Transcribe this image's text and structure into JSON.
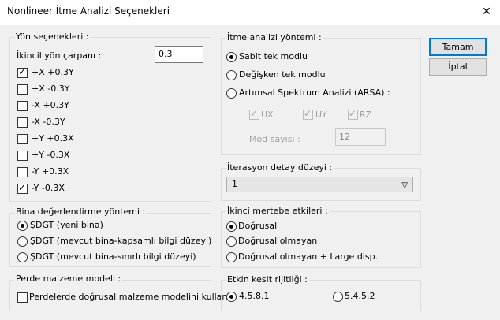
{
  "window": {
    "title": "Nonlineer İtme Analizi Seçenekleri",
    "close_symbol": "✕"
  },
  "yon": {
    "title": "Yön seçenekleri :",
    "ikincil_label": "İkincil yön çarpanı :",
    "ikincil_value": "0.3",
    "items": [
      {
        "label": "+X +0.3Y",
        "checked": true
      },
      {
        "label": "+X -0.3Y",
        "checked": false
      },
      {
        "label": "-X +0.3Y",
        "checked": false
      },
      {
        "label": "-X -0.3Y",
        "checked": false
      },
      {
        "label": "+Y +0.3X",
        "checked": false
      },
      {
        "label": "+Y -0.3X",
        "checked": false
      },
      {
        "label": "-Y +0.3X",
        "checked": false
      },
      {
        "label": "-Y -0.3X",
        "checked": true
      }
    ]
  },
  "bina": {
    "title": "Bina değerlendirme yöntemi :",
    "options": [
      {
        "label": "ŞDGT (yeni bina)",
        "checked": true
      },
      {
        "label": "ŞDGT (mevcut bina-kapsamlı bilgi düzeyi)",
        "checked": false
      },
      {
        "label": "ŞDGT (mevcut bina-sınırlı bilgi düzeyi)",
        "checked": false
      }
    ]
  },
  "perde": {
    "title": "Perde malzeme modeli :",
    "checkbox_label": "Perdelerde doğrusal malzeme modelini kullan"
  },
  "itme": {
    "title": "İtme analizi yöntemi :",
    "options": [
      {
        "label": "Sabit tek modlu",
        "checked": true
      },
      {
        "label": "Değişken tek modlu",
        "checked": false
      },
      {
        "label": "Artımsal Spektrum Analizi (ARSA) :",
        "checked": false
      }
    ],
    "arsa": {
      "ux": "UX",
      "uy": "UY",
      "rz": "RZ",
      "mod_label": "Mod sayısı :",
      "mod_value": "12"
    }
  },
  "iterasyon": {
    "title": "İterasyon detay düzeyi :",
    "selected": "1"
  },
  "ikinci": {
    "title": "İkinci mertebe etkileri :",
    "options": [
      {
        "label": "Doğrusal",
        "checked": true
      },
      {
        "label": "Doğrusal olmayan",
        "checked": false
      },
      {
        "label": "Doğrusal olmayan + Large disp.",
        "checked": false
      }
    ]
  },
  "etkin": {
    "title": "Etkin kesit rijitliği :",
    "options": [
      {
        "label": "4.5.8.1",
        "checked": true
      },
      {
        "label": "5.4.5.2",
        "checked": false
      }
    ]
  },
  "buttons": {
    "ok": "Tamam",
    "cancel": "İptal"
  }
}
